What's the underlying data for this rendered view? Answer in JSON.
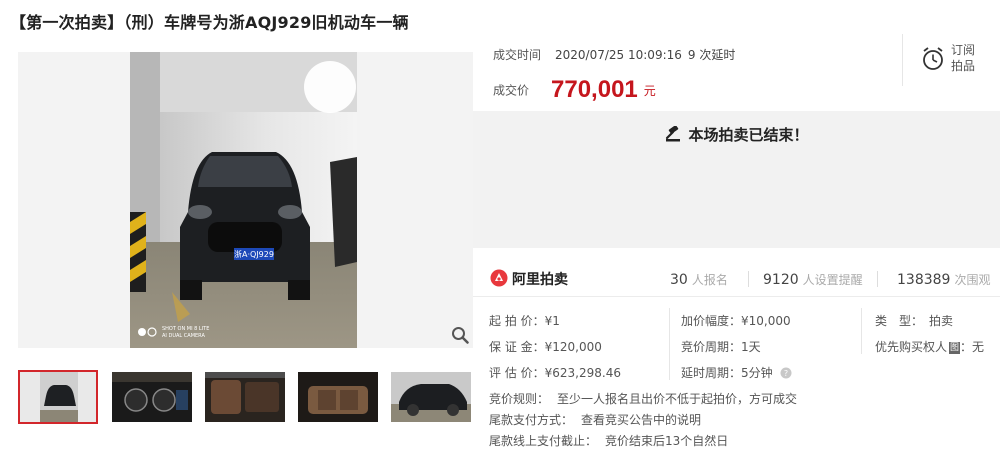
{
  "title": "【第一次拍卖】（刑）车牌号为浙AQJ929旧机动车一辆",
  "deal": {
    "time_label": "成交时间",
    "time_value": "2020/07/25 10:09:16",
    "delay_value": "9 次延时",
    "price_label": "成交价",
    "price_value": "770,001",
    "price_unit": "元"
  },
  "subscribe": {
    "label": "订阅拍品",
    "icon": "alarm-clock-icon"
  },
  "ended_message": "本场拍卖已结束！",
  "platform": {
    "logo_text": "阿里拍卖",
    "signups_count": "30",
    "signups_label": "人报名",
    "reminders_count": "9120",
    "reminders_label": "人设置提醒",
    "views_count": "138389",
    "views_label": "次围观"
  },
  "params": {
    "start_price": "起 拍 价：¥1",
    "deposit": "保 证 金：¥120,000",
    "valuation": "评 估 价：¥623,298.46",
    "increment": "加价幅度：¥10,000",
    "period": "竞价周期：1天",
    "delay_cycle": "延时周期：5分钟",
    "type_label": "类　型：",
    "type_value": "拍卖",
    "priority_label": "优先购买权人",
    "priority_badge": "图",
    "priority_value": "：无"
  },
  "rules": [
    {
      "label": "竞价规则：",
      "value": "至少一人报名且出价不低于起拍价，方可成交"
    },
    {
      "label": "尾款支付方式：",
      "value": "查看竞买公告中的说明"
    },
    {
      "label": "尾款线上支付截止：",
      "value": "竞价结束后13个自然日"
    }
  ],
  "photo": {
    "plate": "浙A·QJ929",
    "watermark_line1": "SHOT ON MI 8 LITE",
    "watermark_line2": "AI DUAL CAMERA"
  },
  "colors": {
    "accent": "#c5161d",
    "thumb_border": "#d2262b"
  }
}
